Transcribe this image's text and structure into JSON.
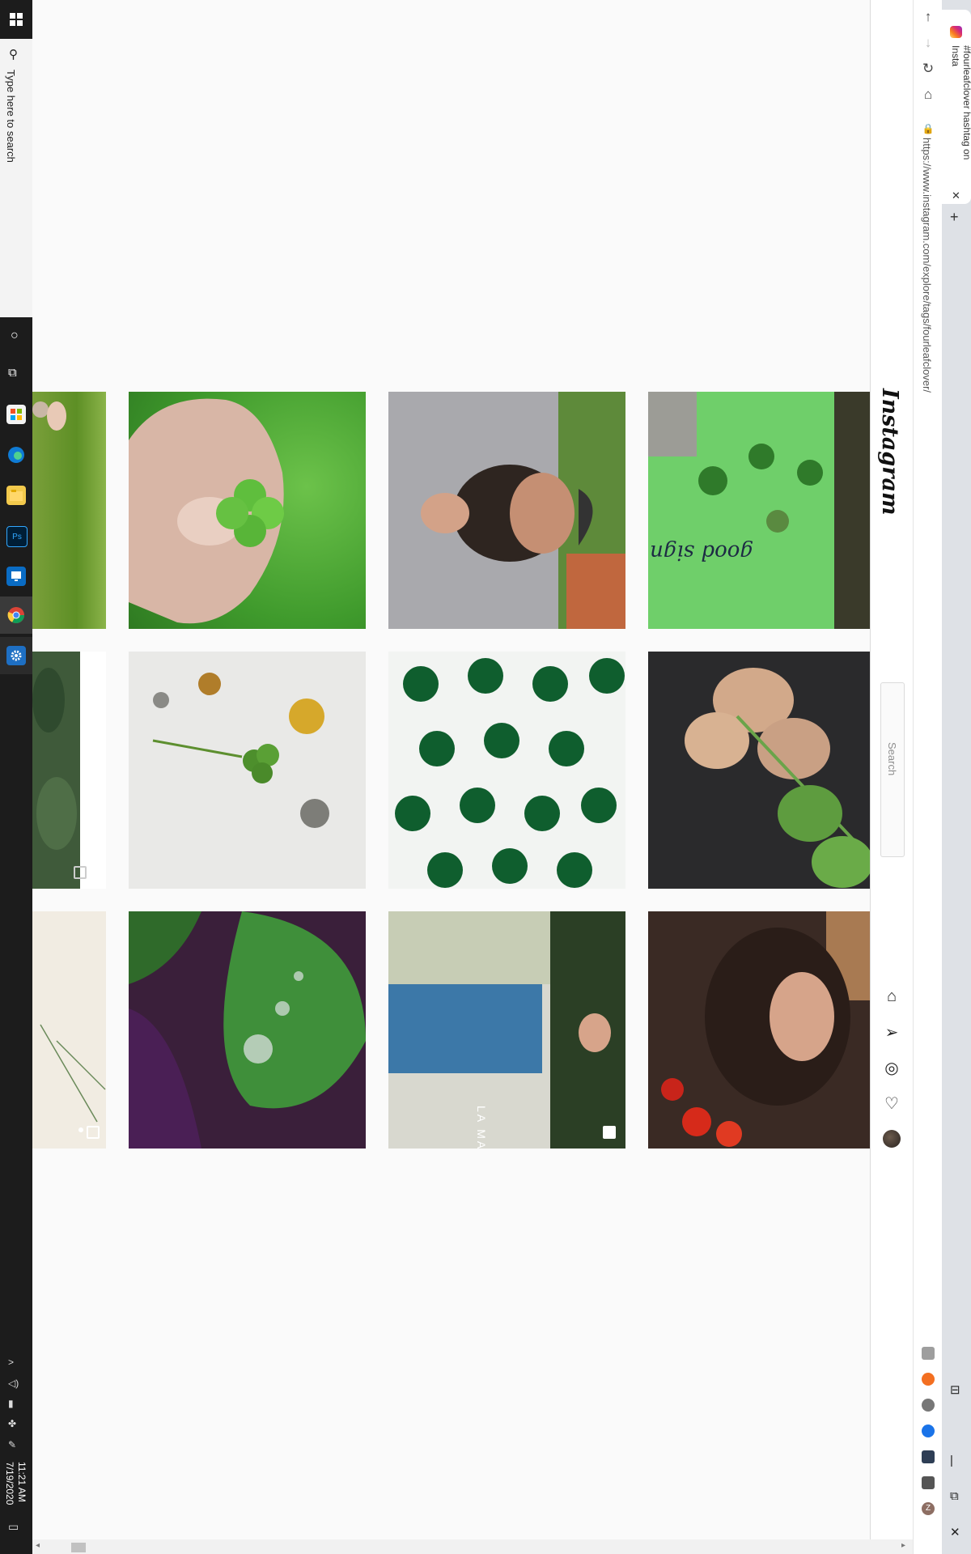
{
  "taskbar": {
    "search_placeholder": "Type here to search",
    "clock_time": "11:21 AM",
    "clock_date": "7/19/2020",
    "apps": [
      "microsoft-store-icon",
      "edge-icon",
      "file-explorer-icon",
      "photoshop-icon",
      "remote-desktop-icon",
      "chrome-icon",
      "settings-gear-icon"
    ]
  },
  "browser": {
    "tab_title": "#fourleafclover hashtag on Insta",
    "url": "https://www.instagram.com/explore/tags/fourleafclover/",
    "nav": [
      "back",
      "forward",
      "reload",
      "home"
    ],
    "extensions": [
      "grammarly",
      "ext-orange",
      "ext-circle",
      "ext-blue",
      "ext-photo",
      "puzzle",
      "profile-z"
    ],
    "profile_initial": "Z"
  },
  "instagram": {
    "logo": "Instagram",
    "search_placeholder": "Search",
    "nav_icons": [
      "home-icon",
      "direct-icon",
      "explore-icon",
      "activity-heart-icon",
      "profile-avatar"
    ]
  },
  "posts": {
    "row1": [
      "Clover in hand",
      "Bearded man with clover",
      "This is a good sign painting"
    ],
    "row2": [
      "Clover on cracked paint",
      "Green clover tiles",
      "Dried and fresh clover"
    ],
    "row3": [
      "Purple and green leaves with droplets",
      "Woman in blue dress",
      "Woman with red flowers"
    ],
    "painting_text": "This is a good sign",
    "dress_text": "LA MARQUISE"
  },
  "colors": {
    "taskbar_bg": "#1c1c1c",
    "page_bg": "#fafafa",
    "tab_strip": "#dee1e6"
  }
}
